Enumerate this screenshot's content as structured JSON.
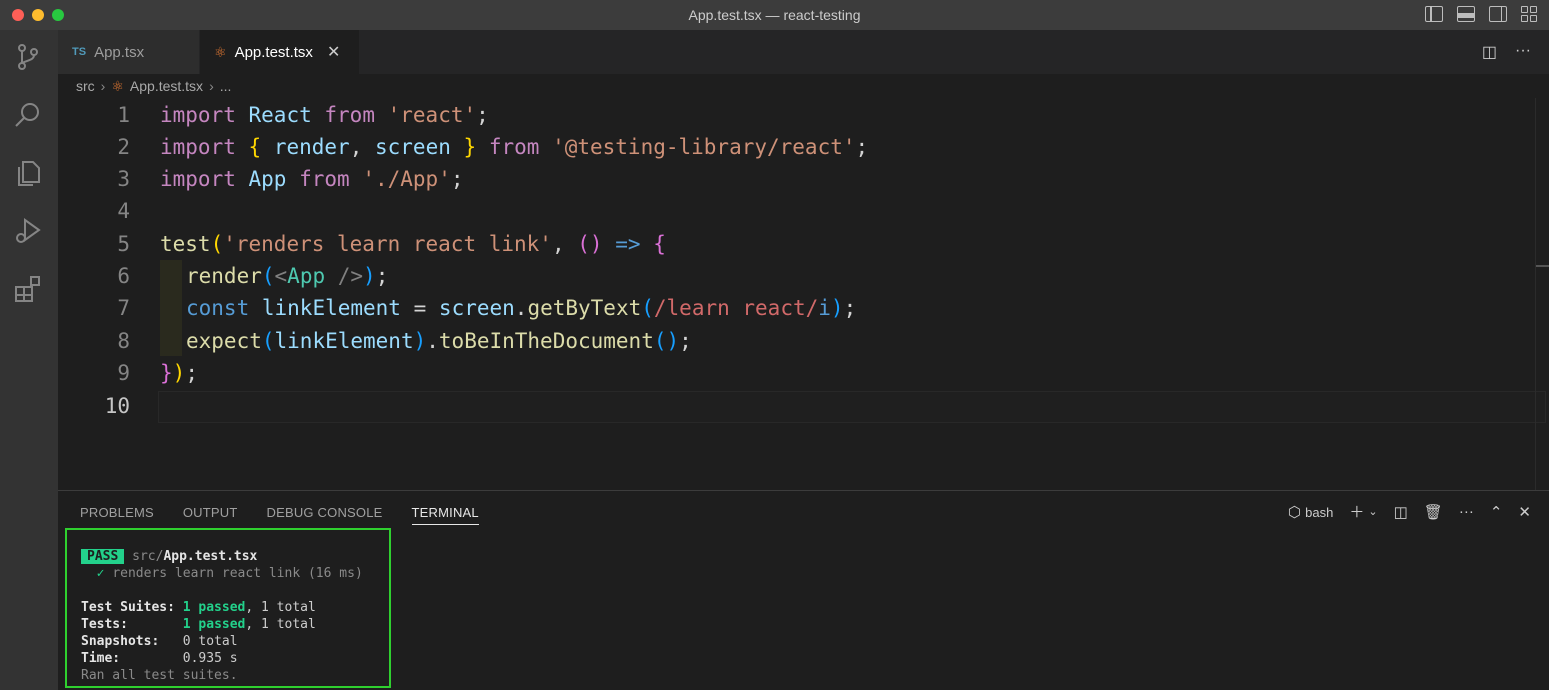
{
  "window": {
    "title": "App.test.tsx — react-testing"
  },
  "tabs": [
    {
      "badge": "TS",
      "label": "App.tsx"
    },
    {
      "label": "App.test.tsx",
      "close": "✕"
    }
  ],
  "breadcrumb": {
    "folder": "src",
    "file": "App.test.tsx",
    "more": "..."
  },
  "editor": {
    "line_numbers": [
      "1",
      "2",
      "3",
      "4",
      "5",
      "6",
      "7",
      "8",
      "9",
      "10"
    ],
    "active_line": "10",
    "code": {
      "l1": {
        "t1": "import",
        "t2": "React",
        "t3": "from",
        "t4": "'react'",
        "t5": ";"
      },
      "l2": {
        "t1": "import",
        "t2": "{",
        "t3": "render",
        "t4": ",",
        "t5": "screen",
        "t6": "}",
        "t7": "from",
        "t8": "'@testing-library/react'",
        "t9": ";"
      },
      "l3": {
        "t1": "import",
        "t2": "App",
        "t3": "from",
        "t4": "'./App'",
        "t5": ";"
      },
      "l5": {
        "t1": "test",
        "t2": "(",
        "t3": "'renders learn react link'",
        "t4": ",",
        "t5": "()",
        "t6": "=>",
        "t7": "{"
      },
      "l6": {
        "t1": "render",
        "t2": "(",
        "t3": "<",
        "t4": "App",
        "t5": " />",
        "t6": ")",
        "t7": ";"
      },
      "l7": {
        "t1": "const",
        "t2": "linkElement",
        "t3": "=",
        "t4": "screen",
        "t5": ".",
        "t6": "getByText",
        "t7": "(",
        "t8": "/learn react/",
        "t9": "i",
        "t10": ")",
        "t11": ";"
      },
      "l8": {
        "t1": "expect",
        "t2": "(",
        "t3": "linkElement",
        "t4": ")",
        "t5": ".",
        "t6": "toBeInTheDocument",
        "t7": "()",
        "t8": ";"
      },
      "l9": {
        "t1": "}",
        "t2": ")",
        "t3": ";"
      }
    }
  },
  "panel": {
    "tabs": [
      "PROBLEMS",
      "OUTPUT",
      "DEBUG CONSOLE",
      "TERMINAL"
    ],
    "active_tab": "TERMINAL",
    "shell": "bash"
  },
  "terminal": {
    "pass_badge": "PASS",
    "file_dir": "src/",
    "file_name": "App.test.tsx",
    "test_check": "✓",
    "test_name": "renders learn react link (16 ms)",
    "suites_label": "Test Suites:",
    "suites_passed": "1 passed",
    "suites_total": ", 1 total",
    "tests_label": "Tests:",
    "tests_passed": "1 passed",
    "tests_total": ", 1 total",
    "snapshots_label": "Snapshots:",
    "snapshots_value": "0 total",
    "time_label": "Time:",
    "time_value": "0.935 s",
    "footer": "Ran all test suites."
  },
  "colors": {
    "pass_green": "#23d18b",
    "highlight_border": "#2fd02f"
  },
  "icons": [
    "source-control-icon",
    "search-icon",
    "explorer-icon",
    "run-debug-icon",
    "extensions-icon",
    "split-editor-icon",
    "more-icon",
    "new-terminal-icon",
    "chevron-down-icon",
    "split-terminal-icon",
    "trash-icon",
    "maximize-panel-icon",
    "close-panel-icon"
  ]
}
